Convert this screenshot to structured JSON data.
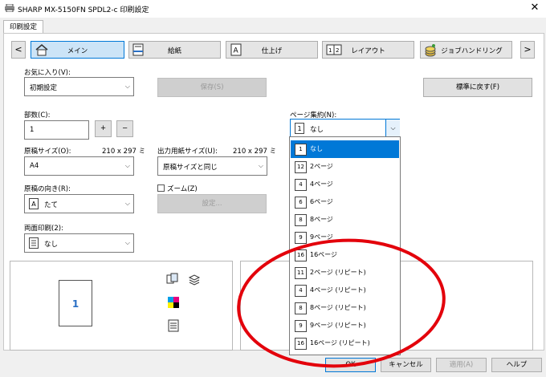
{
  "window": {
    "title": "SHARP MX-5150FN SPDL2-c 印刷設定",
    "close_glyph": "✕"
  },
  "tabs": [
    {
      "label": "印刷設定"
    }
  ],
  "nav": {
    "left_arrow": "<",
    "right_arrow": ">",
    "items": [
      {
        "label": "メイン",
        "icon": "home-icon"
      },
      {
        "label": "給紙",
        "icon": "paper-tray-icon"
      },
      {
        "label": "仕上げ",
        "icon": "finishing-icon"
      },
      {
        "label": "レイアウト",
        "icon": "layout-icon"
      },
      {
        "label": "ジョブハンドリング",
        "icon": "job-handling-icon"
      }
    ]
  },
  "favorites": {
    "label": "お気に入り(V):",
    "value": "初期設定",
    "save_label": "保存(S)",
    "reset_label": "標準に戻す(F)"
  },
  "copies": {
    "label": "部数(C):",
    "value": "1",
    "plus": "+",
    "minus": "−"
  },
  "original_size": {
    "label": "原稿サイズ(O):",
    "dims": "210 x 297 ミ",
    "value": "A4"
  },
  "output_size": {
    "label": "出力用紙サイズ(U):",
    "dims": "210 x 297 ミ",
    "value": "原稿サイズと同じ"
  },
  "orientation": {
    "label": "原稿の向き(R):",
    "value": "たて",
    "icon_glyph": "A"
  },
  "zoom": {
    "label": "ズーム(Z)",
    "settings_label": "設定..."
  },
  "duplex": {
    "label": "両面印刷(2):",
    "value": "なし"
  },
  "page_aggregation": {
    "label": "ページ集約(N):",
    "value": "なし",
    "icon_glyph": "1",
    "options": [
      {
        "label": "なし",
        "glyph": "1"
      },
      {
        "label": "2ページ",
        "glyph": "12"
      },
      {
        "label": "4ページ",
        "glyph": "4"
      },
      {
        "label": "6ページ",
        "glyph": "6"
      },
      {
        "label": "8ページ",
        "glyph": "8"
      },
      {
        "label": "9ページ",
        "glyph": "9"
      },
      {
        "label": "16ページ",
        "glyph": "16"
      },
      {
        "label": "2ページ (リピート)",
        "glyph": "11"
      },
      {
        "label": "4ページ (リピート)",
        "glyph": "4"
      },
      {
        "label": "8ページ (リピート)",
        "glyph": "8"
      },
      {
        "label": "9ページ (リピート)",
        "glyph": "9"
      },
      {
        "label": "16ページ (リピート)",
        "glyph": "16"
      }
    ]
  },
  "preview": {
    "page_number": "1"
  },
  "bottom": {
    "ok": "OK",
    "cancel": "キャンセル",
    "apply": "適用(A)",
    "help": "ヘルプ"
  },
  "colors": {
    "accent": "#0078d7",
    "annotation": "#e3000b"
  }
}
